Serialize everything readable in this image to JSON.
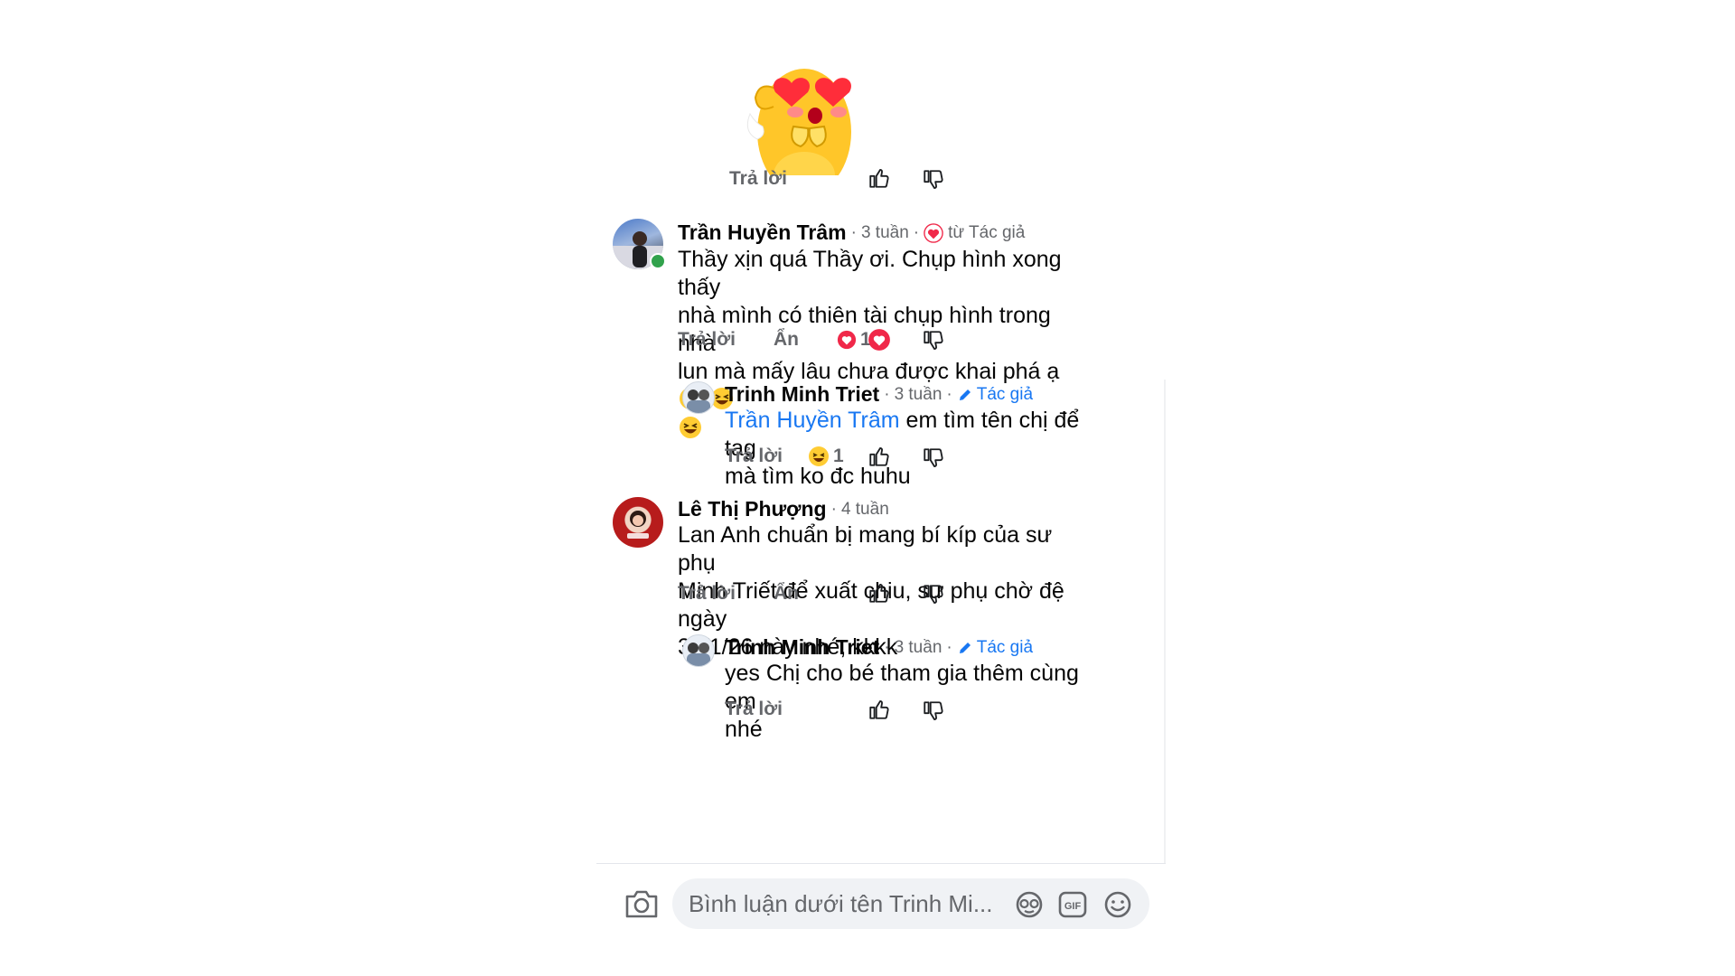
{
  "sticker": {
    "icon": "heart-eyes-character-sticker"
  },
  "actions": {
    "reply": "Trả lời",
    "hide": "Ẩn"
  },
  "comments": [
    {
      "author": "Trần Huyền Trâm",
      "time": "3 tuần",
      "badge": "từ Tác giả",
      "text_lines": [
        "Thầy xịn quá Thầy ơi. Chụp hình xong thấy",
        "nhà mình có thiên tài chụp hình trong nhà",
        "lun mà mấy lâu chưa được khai phá ạ"
      ],
      "reaction_count": "1",
      "reaction_icon": "heart-reaction-icon",
      "online": true
    },
    {
      "author": "Trinh Minh Triet",
      "time": "3 tuần",
      "badge": "Tác giả",
      "mention": "Trần Huyền Trâm",
      "text_lines": [
        " em tìm tên chị để tag",
        "mà tìm ko đc huhu"
      ],
      "reaction_count": "1",
      "reaction_icon": "haha-reaction-icon"
    },
    {
      "author": "Lê Thị Phượng",
      "time": "4 tuần",
      "text_lines": [
        "Lan Anh chuẩn bị mang bí kíp của sư phụ",
        "Minh Triết để xuất chiu, sư phụ chờ đệ ngày",
        "30/1/26 này nhé, kkkk"
      ]
    },
    {
      "author": "Trinh Minh Triet",
      "time": "3 tuần",
      "badge": "Tác giả",
      "text_lines": [
        "yes Chị cho bé tham gia thêm cùng em",
        "nhé"
      ]
    }
  ],
  "composer": {
    "placeholder": "Bình luận dưới tên Trinh Mi..."
  },
  "colors": {
    "link": "#1877f2",
    "secondary_text": "#65676b",
    "heart": "#f02849",
    "online": "#31a24c"
  }
}
